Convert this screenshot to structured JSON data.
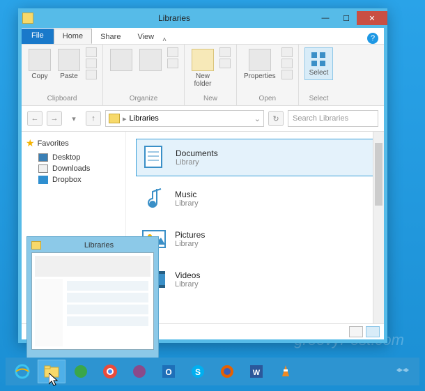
{
  "window": {
    "title": "Libraries",
    "tabs": {
      "file": "File",
      "home": "Home",
      "share": "Share",
      "view": "View"
    }
  },
  "ribbon": {
    "clipboard": {
      "label": "Clipboard",
      "copy": "Copy",
      "paste": "Paste"
    },
    "organize": {
      "label": "Organize"
    },
    "new": {
      "label": "New",
      "newfolder": "New\nfolder"
    },
    "open": {
      "label": "Open",
      "properties": "Properties"
    },
    "select": {
      "label": "Select",
      "select": "Select"
    }
  },
  "nav": {
    "address": "Libraries",
    "search_placeholder": "Search Libraries"
  },
  "sidebar": {
    "favorites": "Favorites",
    "items": [
      {
        "label": "Desktop"
      },
      {
        "label": "Downloads"
      },
      {
        "label": "Dropbox"
      }
    ]
  },
  "libraries": [
    {
      "name": "Documents",
      "sub": "Library"
    },
    {
      "name": "Music",
      "sub": "Library"
    },
    {
      "name": "Pictures",
      "sub": "Library"
    },
    {
      "name": "Videos",
      "sub": "Library"
    }
  ],
  "preview": {
    "title": "Libraries"
  },
  "watermark": "groovyPost.com"
}
